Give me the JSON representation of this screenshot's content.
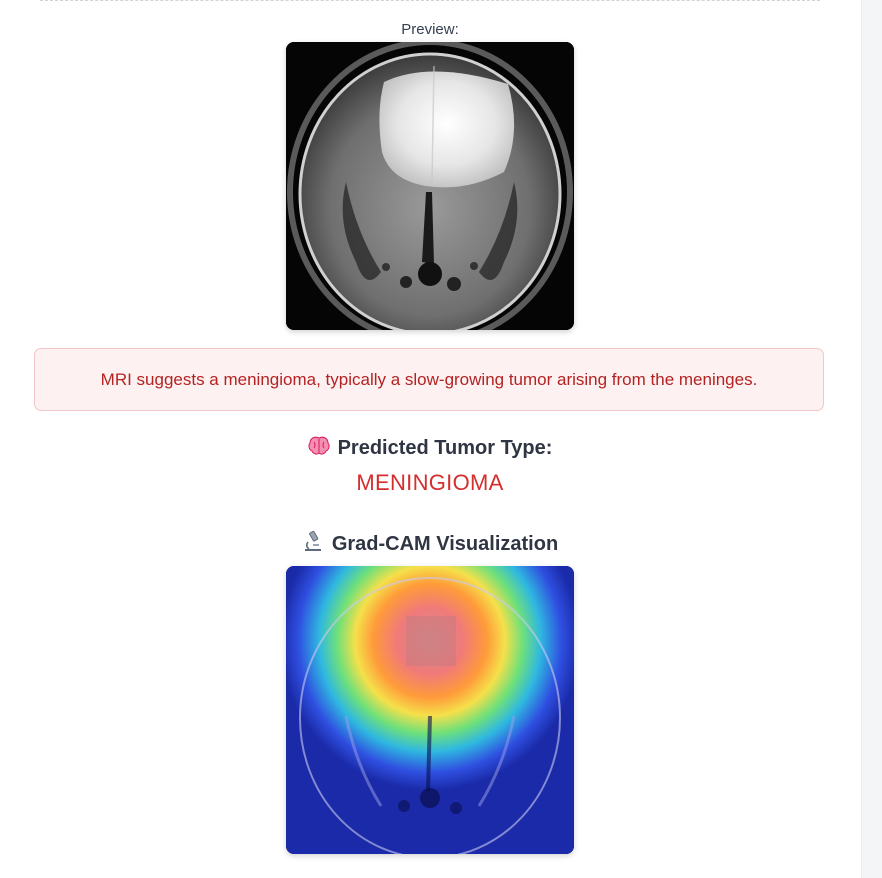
{
  "preview": {
    "label": "Preview:"
  },
  "alert": {
    "message": "MRI suggests a meningioma, typically a slow-growing tumor arising from the meninges."
  },
  "prediction": {
    "heading": "Predicted Tumor Type:",
    "value": "MENINGIOMA",
    "icon": "brain-icon"
  },
  "gradcam": {
    "heading": "Grad-CAM Visualization",
    "icon": "microscope-icon"
  },
  "colors": {
    "alert_text": "#b42323",
    "alert_bg": "#fdf1f1",
    "prediction_value": "#d32f2f",
    "heading_text": "#2f3542"
  }
}
